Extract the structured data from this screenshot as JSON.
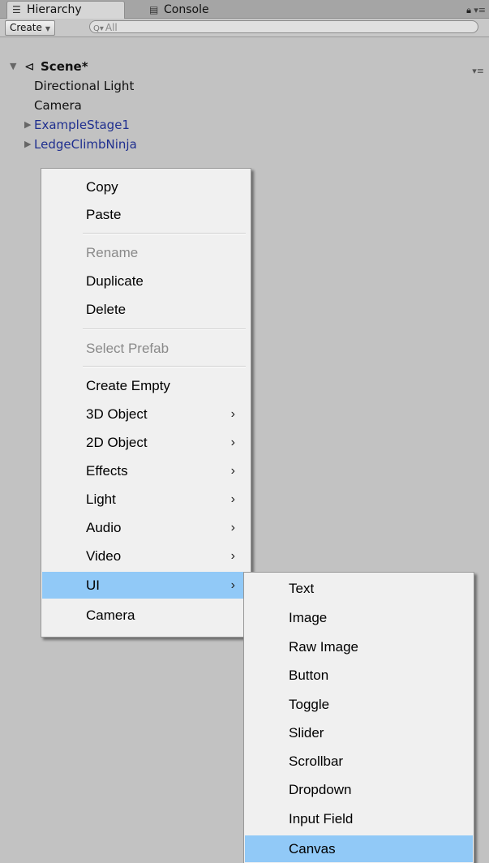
{
  "tabs": {
    "hierarchy": "Hierarchy",
    "console": "Console"
  },
  "toolbar": {
    "create_label": "Create",
    "search_placeholder": "All"
  },
  "scene": {
    "name": "Scene*",
    "items": [
      {
        "label": "Directional Light",
        "prefab": false
      },
      {
        "label": "Camera",
        "prefab": false
      },
      {
        "label": "ExampleStage1",
        "prefab": true
      },
      {
        "label": "LedgeClimbNinja",
        "prefab": true
      }
    ]
  },
  "context_menu": {
    "items": [
      {
        "label": "Copy"
      },
      {
        "label": "Paste"
      },
      {
        "label": "Rename",
        "disabled": true
      },
      {
        "label": "Duplicate"
      },
      {
        "label": "Delete"
      },
      {
        "label": "Select Prefab",
        "disabled": true
      },
      {
        "label": "Create Empty"
      },
      {
        "label": "3D Object",
        "submenu": true
      },
      {
        "label": "2D Object",
        "submenu": true
      },
      {
        "label": "Effects",
        "submenu": true
      },
      {
        "label": "Light",
        "submenu": true
      },
      {
        "label": "Audio",
        "submenu": true
      },
      {
        "label": "Video",
        "submenu": true
      },
      {
        "label": "UI",
        "submenu": true,
        "highlighted": true
      },
      {
        "label": "Camera"
      }
    ]
  },
  "ui_submenu": {
    "items": [
      {
        "label": "Text"
      },
      {
        "label": "Image"
      },
      {
        "label": "Raw Image"
      },
      {
        "label": "Button"
      },
      {
        "label": "Toggle"
      },
      {
        "label": "Slider"
      },
      {
        "label": "Scrollbar"
      },
      {
        "label": "Dropdown"
      },
      {
        "label": "Input Field"
      },
      {
        "label": "Canvas",
        "highlighted": true
      }
    ]
  },
  "colors": {
    "panel_bg": "#c2c2c2",
    "prefab_text": "#1f2f8f",
    "menu_bg": "#f0f0f0",
    "highlight": "#91c9f7",
    "disabled_text": "#8a8a8a"
  }
}
